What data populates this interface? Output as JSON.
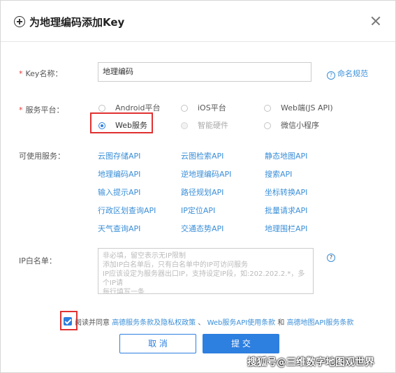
{
  "dialog": {
    "title": "为地理编码添加Key"
  },
  "key_name": {
    "label": "Key名称：",
    "value": "地理编码",
    "help_label": "命名规范"
  },
  "platform": {
    "label": "服务平台：",
    "options": [
      {
        "label": "Android平台",
        "state": "unselected"
      },
      {
        "label": "iOS平台",
        "state": "unselected"
      },
      {
        "label": "Web端(JS API)",
        "state": "unselected"
      },
      {
        "label": "Web服务",
        "state": "selected"
      },
      {
        "label": "智能硬件",
        "state": "disabled"
      },
      {
        "label": "微信小程序",
        "state": "unselected"
      }
    ]
  },
  "services": {
    "label": "可使用服务：",
    "items": [
      "云图存储API",
      "云图检索API",
      "静态地图API",
      "地理编码API",
      "逆地理编码API",
      "搜索API",
      "输入提示API",
      "路径规划API",
      "坐标转换API",
      "行政区划查询API",
      "IP定位API",
      "批量请求API",
      "天气查询API",
      "交通态势API",
      "地理围栏API"
    ]
  },
  "ip_whitelist": {
    "label": "IP白名单：",
    "placeholder": "非必填，留空表示无IP限制\n添加IP白名单后，只有白名单中的IP可访问服务\nIP应该设定为服务器出口IP，支持设定IP段，如:202.202.2.*，多个IP请\n每行填写一条"
  },
  "agreement": {
    "checked": true,
    "prefix": "阅读并同意",
    "link1": "高德服务条款及隐私权政策",
    "sep1": "、",
    "link2": "Web服务API使用条款",
    "sep2": "和",
    "link3": "高德地图API服务条款"
  },
  "buttons": {
    "cancel": "取 消",
    "submit": "提 交"
  },
  "watermark": "搜狐号@三维数字地图观世界",
  "colors": {
    "accent": "#2d7fe0",
    "link": "#3b8fd8",
    "required": "#e5393b",
    "highlight_box": "#e03131"
  }
}
